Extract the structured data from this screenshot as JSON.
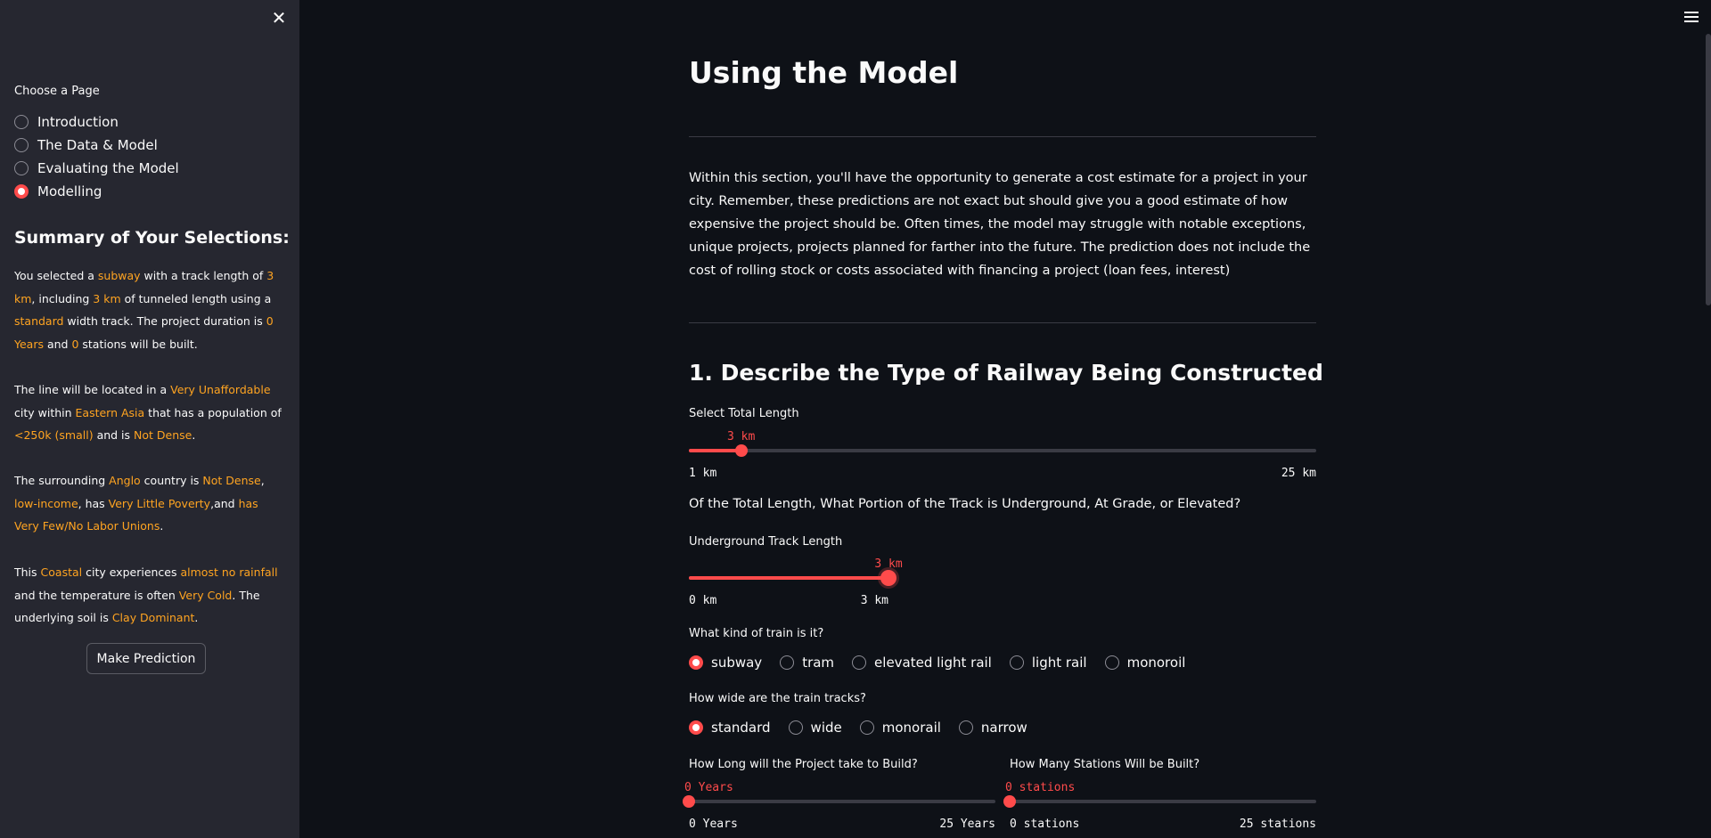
{
  "sidebar": {
    "nav_label": "Choose a Page",
    "pages": [
      {
        "label": "Introduction",
        "selected": false
      },
      {
        "label": "The Data & Model",
        "selected": false
      },
      {
        "label": "Evaluating the Model",
        "selected": false
      },
      {
        "label": "Modelling",
        "selected": true
      }
    ],
    "summary_title": "Summary of Your Selections:",
    "p1": {
      "t1": "You selected a ",
      "train_type": "subway",
      "t2": " with a track length of ",
      "length": "3 km",
      "t3": ", including ",
      "tunneled": "3 km",
      "t4": " of tunneled length using a ",
      "width": "standard",
      "t5": " width track. The project duration is ",
      "duration": "0 Years",
      "t6": " and ",
      "stations": "0",
      "t7": " stations will be built."
    },
    "p2": {
      "t1": "The line will be located in a ",
      "affordability": "Very Unaffordable",
      "t2": " city within ",
      "region": "Eastern Asia",
      "t3": " that has a population of ",
      "population": "<250k (small)",
      "t4": " and is ",
      "density": "Not Dense",
      "t5": "."
    },
    "p3": {
      "t1": "The surrounding ",
      "country_type": "Anglo",
      "t2": " country is ",
      "country_density": "Not Dense",
      "t3": ", ",
      "income": "low-income",
      "t4": ", has ",
      "poverty": "Very Little Poverty",
      "t5": ",and ",
      "unions": "has Very Few/No Labor Unions",
      "t6": "."
    },
    "p4": {
      "t1": "This ",
      "coastal": "Coastal",
      "t2": " city experiences ",
      "rainfall": "almost no rainfall",
      "t3": " and the temperature is often ",
      "temperature": "Very Cold",
      "t4": ". The underlying soil is ",
      "soil": "Clay Dominant",
      "t5": "."
    },
    "predict_label": "Make Prediction"
  },
  "main": {
    "title": "Using the Model",
    "intro": "Within this section, you'll have the opportunity to generate a cost estimate for a project in your city. Remember, these predictions are not exact but should give you a good estimate of how expensive the project should be. Often times, the model may struggle with notable exceptions, unique projects, projects planned for farther into the future. The prediction does not include the cost of rolling stock or costs associated with financing a project (loan fees, interest)",
    "section_title": "1. Describe the Type of Railway Being Constructed",
    "total_length": {
      "label": "Select Total Length",
      "value_label": "3 km",
      "min_label": "1 km",
      "max_label": "25 km",
      "min": 1,
      "max": 25,
      "value": 3
    },
    "portion_question": "Of the Total Length, What Portion of the Track is Underground, At Grade, or Elevated?",
    "underground": {
      "label": "Underground Track Length",
      "value_label": "3 km",
      "min_label": "0 km",
      "max_label": "3 km",
      "min": 0,
      "max": 3,
      "value": 3
    },
    "train_kind": {
      "label": "What kind of train is it?",
      "options": [
        {
          "label": "subway",
          "selected": true
        },
        {
          "label": "tram",
          "selected": false
        },
        {
          "label": "elevated light rail",
          "selected": false
        },
        {
          "label": "light rail",
          "selected": false
        },
        {
          "label": "monoroil",
          "selected": false
        }
      ]
    },
    "track_width": {
      "label": "How wide are the train tracks?",
      "options": [
        {
          "label": "standard",
          "selected": true
        },
        {
          "label": "wide",
          "selected": false
        },
        {
          "label": "monorail",
          "selected": false
        },
        {
          "label": "narrow",
          "selected": false
        }
      ]
    },
    "duration": {
      "label": "How Long will the Project take to Build?",
      "value_label": "0 Years",
      "min_label": "0 Years",
      "max_label": "25 Years",
      "min": 0,
      "max": 25,
      "value": 0
    },
    "stations": {
      "label": "How Many Stations Will be Built?",
      "value_label": "0 stations",
      "min_label": "0 stations",
      "max_label": "25 stations",
      "min": 0,
      "max": 25,
      "value": 0
    }
  },
  "colors": {
    "accent": "#ff4b4b",
    "highlight": "#ffa421",
    "sidebar_bg": "#262730",
    "main_bg": "#0e1117"
  }
}
